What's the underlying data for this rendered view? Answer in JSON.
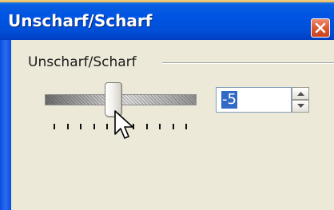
{
  "window": {
    "title": "Unscharf/Scharf"
  },
  "group": {
    "label": "Unscharf/Scharf"
  },
  "slider": {
    "tick_count": 11,
    "level_fraction": 0.45
  },
  "spin": {
    "value": "-5"
  },
  "icons": {
    "close": "close-icon",
    "spin_up": "spin-up-arrow-icon",
    "spin_down": "spin-down-arrow-icon",
    "cursor": "mouse-cursor-icon"
  },
  "colors": {
    "title_bar": "#0054e3",
    "dialog_bg": "#ece9d8",
    "close_button": "#dd5b36",
    "selection": "#316ac5"
  }
}
